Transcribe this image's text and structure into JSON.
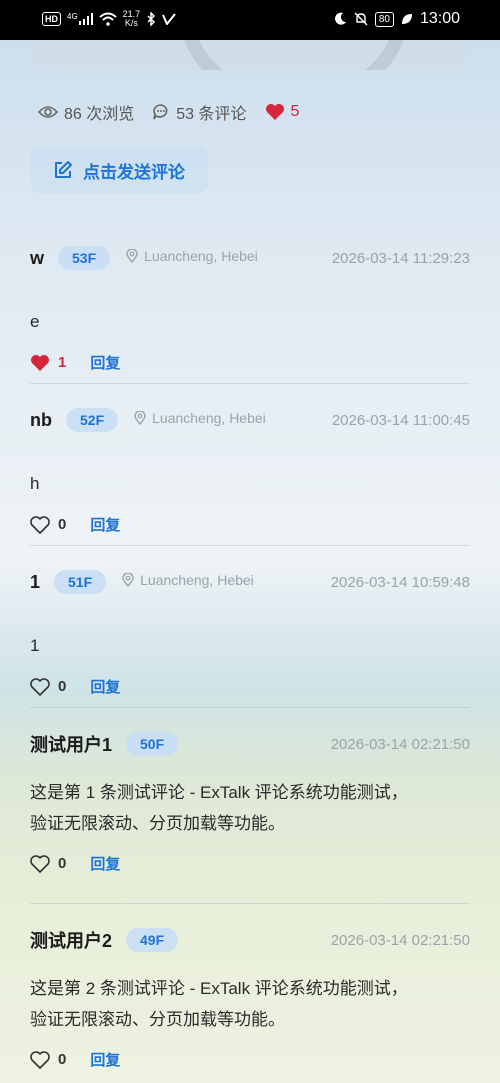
{
  "statusbar": {
    "hd": "HD",
    "signal": "4G",
    "net_speed": "21.7",
    "net_unit": "K/s",
    "battery": "80",
    "time": "13:00"
  },
  "stats": {
    "views": "86 次浏览",
    "comments": "53 条评论",
    "likes": "5"
  },
  "send_button": {
    "label": "点击发送评论"
  },
  "colors": {
    "accent": "#1e73d6",
    "like": "#d6263b"
  },
  "comments": [
    {
      "user": "w",
      "floor": "53F",
      "location": "Luancheng, Hebei",
      "time": "2026-03-14 11:29:23",
      "body": "e",
      "likes": "1",
      "liked": true,
      "reply": "回复"
    },
    {
      "user": "nb",
      "floor": "52F",
      "location": "Luancheng, Hebei",
      "time": "2026-03-14 11:00:45",
      "body": "h",
      "likes": "0",
      "liked": false,
      "reply": "回复"
    },
    {
      "user": "1",
      "floor": "51F",
      "location": "Luancheng, Hebei",
      "time": "2026-03-14 10:59:48",
      "body": "1",
      "likes": "0",
      "liked": false,
      "reply": "回复"
    },
    {
      "user": "测试用户1",
      "floor": "50F",
      "location": "",
      "time": "2026-03-14 02:21:50",
      "body_line1": "这是第 1 条测试评论 - ExTalk 评论系统功能测试，",
      "body_line2": "验证无限滚动、分页加载等功能。",
      "likes": "0",
      "liked": false,
      "reply": "回复"
    },
    {
      "user": "测试用户2",
      "floor": "49F",
      "location": "",
      "time": "2026-03-14 02:21:50",
      "body_line1": "这是第 2 条测试评论 - ExTalk 评论系统功能测试，",
      "body_line2": "验证无限滚动、分页加载等功能。",
      "likes": "0",
      "liked": false,
      "reply": "回复"
    }
  ]
}
